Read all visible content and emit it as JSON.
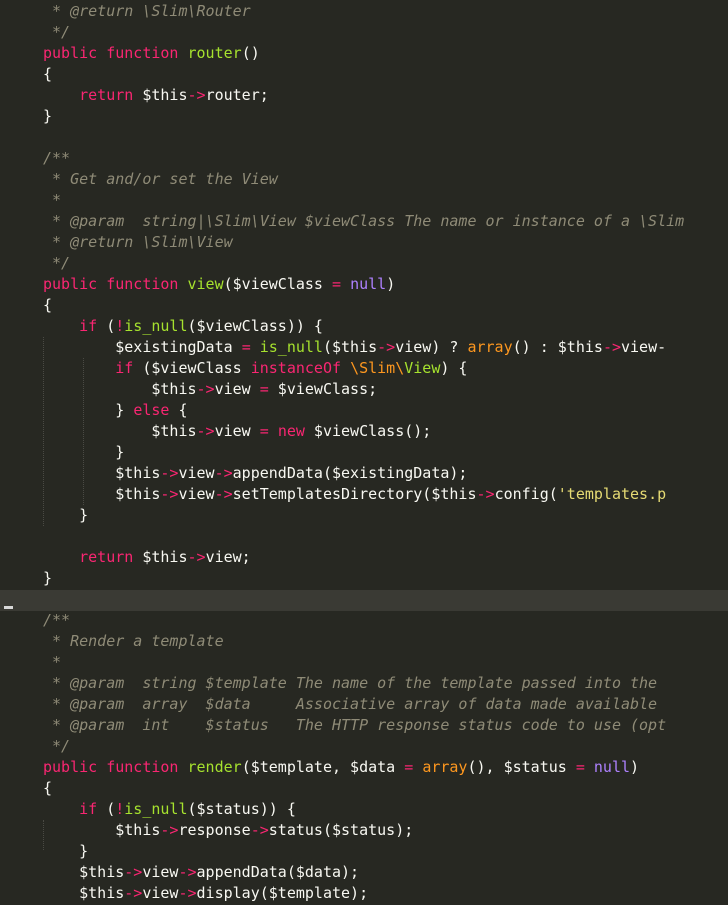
{
  "editor": {
    "language": "php",
    "theme_colors": {
      "background": "#272822",
      "foreground": "#f8f8f2",
      "comment": "#8f8b77",
      "keyword": "#f92672",
      "function": "#a6e22e",
      "string": "#e6db74",
      "constant": "#ae81ff",
      "builtin": "#fd971f",
      "current_line": "#3a3a34"
    },
    "lines": [
      [
        [
          "c",
          " * @return \\Slim\\Router"
        ]
      ],
      [
        [
          "c",
          " */"
        ]
      ],
      [
        [
          "k",
          "public"
        ],
        [
          "p",
          " "
        ],
        [
          "k",
          "function"
        ],
        [
          "p",
          " "
        ],
        [
          "f",
          "router"
        ],
        [
          "p",
          "()"
        ]
      ],
      [
        [
          "p",
          "{"
        ]
      ],
      [
        [
          "p",
          "    "
        ],
        [
          "k",
          "return"
        ],
        [
          "p",
          " $this"
        ],
        [
          "o",
          "->"
        ],
        [
          "p",
          "router;"
        ]
      ],
      [
        [
          "p",
          "}"
        ]
      ],
      [
        [
          "p",
          ""
        ]
      ],
      [
        [
          "c",
          "/**"
        ]
      ],
      [
        [
          "c",
          " * Get and/or set the View"
        ]
      ],
      [
        [
          "c",
          " *"
        ]
      ],
      [
        [
          "c",
          " * @param  string|\\Slim\\View $viewClass The name or instance of a \\Slim"
        ]
      ],
      [
        [
          "c",
          " * @return \\Slim\\View"
        ]
      ],
      [
        [
          "c",
          " */"
        ]
      ],
      [
        [
          "k",
          "public"
        ],
        [
          "p",
          " "
        ],
        [
          "k",
          "function"
        ],
        [
          "p",
          " "
        ],
        [
          "f",
          "view"
        ],
        [
          "p",
          "($viewClass "
        ],
        [
          "o",
          "="
        ],
        [
          "p",
          " "
        ],
        [
          "n",
          "null"
        ],
        [
          "p",
          ")"
        ]
      ],
      [
        [
          "p",
          "{"
        ]
      ],
      [
        [
          "p",
          "    "
        ],
        [
          "k",
          "if"
        ],
        [
          "p",
          " ("
        ],
        [
          "o",
          "!"
        ],
        [
          "f",
          "is_null"
        ],
        [
          "p",
          "($viewClass)) {"
        ]
      ],
      [
        [
          "p",
          "        $existingData "
        ],
        [
          "o",
          "="
        ],
        [
          "p",
          " "
        ],
        [
          "f",
          "is_null"
        ],
        [
          "p",
          "($this"
        ],
        [
          "o",
          "->"
        ],
        [
          "p",
          "view) ? "
        ],
        [
          "b",
          "array"
        ],
        [
          "p",
          "() : $this"
        ],
        [
          "o",
          "->"
        ],
        [
          "p",
          "view-"
        ]
      ],
      [
        [
          "p",
          "        "
        ],
        [
          "k",
          "if"
        ],
        [
          "p",
          " ($viewClass "
        ],
        [
          "k",
          "instanceOf"
        ],
        [
          "p",
          " "
        ],
        [
          "nsk",
          "\\Slim\\"
        ],
        [
          "f",
          "View"
        ],
        [
          "p",
          ") {"
        ]
      ],
      [
        [
          "p",
          "            $this"
        ],
        [
          "o",
          "->"
        ],
        [
          "p",
          "view "
        ],
        [
          "o",
          "="
        ],
        [
          "p",
          " $viewClass;"
        ]
      ],
      [
        [
          "p",
          "        } "
        ],
        [
          "k",
          "else"
        ],
        [
          "p",
          " {"
        ]
      ],
      [
        [
          "p",
          "            $this"
        ],
        [
          "o",
          "->"
        ],
        [
          "p",
          "view "
        ],
        [
          "o",
          "="
        ],
        [
          "p",
          " "
        ],
        [
          "k",
          "new"
        ],
        [
          "p",
          " $viewClass();"
        ]
      ],
      [
        [
          "p",
          "        }"
        ]
      ],
      [
        [
          "p",
          "        $this"
        ],
        [
          "o",
          "->"
        ],
        [
          "p",
          "view"
        ],
        [
          "o",
          "->"
        ],
        [
          "p",
          "appendData($existingData);"
        ]
      ],
      [
        [
          "p",
          "        $this"
        ],
        [
          "o",
          "->"
        ],
        [
          "p",
          "view"
        ],
        [
          "o",
          "->"
        ],
        [
          "p",
          "setTemplatesDirectory($this"
        ],
        [
          "o",
          "->"
        ],
        [
          "p",
          "config("
        ],
        [
          "s",
          "'templates.p"
        ]
      ],
      [
        [
          "p",
          "    }"
        ]
      ],
      [
        [
          "p",
          ""
        ]
      ],
      [
        [
          "p",
          "    "
        ],
        [
          "k",
          "return"
        ],
        [
          "p",
          " $this"
        ],
        [
          "o",
          "->"
        ],
        [
          "p",
          "view;"
        ]
      ],
      [
        [
          "p",
          "}"
        ]
      ],
      [
        [
          "p",
          ""
        ]
      ],
      [
        [
          "c",
          "/**"
        ]
      ],
      [
        [
          "c",
          " * Render a template"
        ]
      ],
      [
        [
          "c",
          " *"
        ]
      ],
      [
        [
          "c",
          " * @param  string $template The name of the template passed into the"
        ]
      ],
      [
        [
          "c",
          " * @param  array  $data     Associative array of data made available"
        ]
      ],
      [
        [
          "c",
          " * @param  int    $status   The HTTP response status code to use (opt"
        ]
      ],
      [
        [
          "c",
          " */"
        ]
      ],
      [
        [
          "k",
          "public"
        ],
        [
          "p",
          " "
        ],
        [
          "k",
          "function"
        ],
        [
          "p",
          " "
        ],
        [
          "f",
          "render"
        ],
        [
          "p",
          "($template, $data "
        ],
        [
          "o",
          "="
        ],
        [
          "p",
          " "
        ],
        [
          "b",
          "array"
        ],
        [
          "p",
          "(), $status "
        ],
        [
          "o",
          "="
        ],
        [
          "p",
          " "
        ],
        [
          "n",
          "null"
        ],
        [
          "p",
          ")"
        ]
      ],
      [
        [
          "p",
          "{"
        ]
      ],
      [
        [
          "p",
          "    "
        ],
        [
          "k",
          "if"
        ],
        [
          "p",
          " ("
        ],
        [
          "o",
          "!"
        ],
        [
          "f",
          "is_null"
        ],
        [
          "p",
          "($status)) {"
        ]
      ],
      [
        [
          "p",
          "        $this"
        ],
        [
          "o",
          "->"
        ],
        [
          "p",
          "response"
        ],
        [
          "o",
          "->"
        ],
        [
          "p",
          "status($status);"
        ]
      ],
      [
        [
          "p",
          "    }"
        ]
      ],
      [
        [
          "p",
          "    $this"
        ],
        [
          "o",
          "->"
        ],
        [
          "p",
          "view"
        ],
        [
          "o",
          "->"
        ],
        [
          "p",
          "appendData($data);"
        ]
      ],
      [
        [
          "p",
          "    $this"
        ],
        [
          "o",
          "->"
        ],
        [
          "p",
          "view"
        ],
        [
          "o",
          "->"
        ],
        [
          "p",
          "display($template);"
        ]
      ]
    ]
  }
}
